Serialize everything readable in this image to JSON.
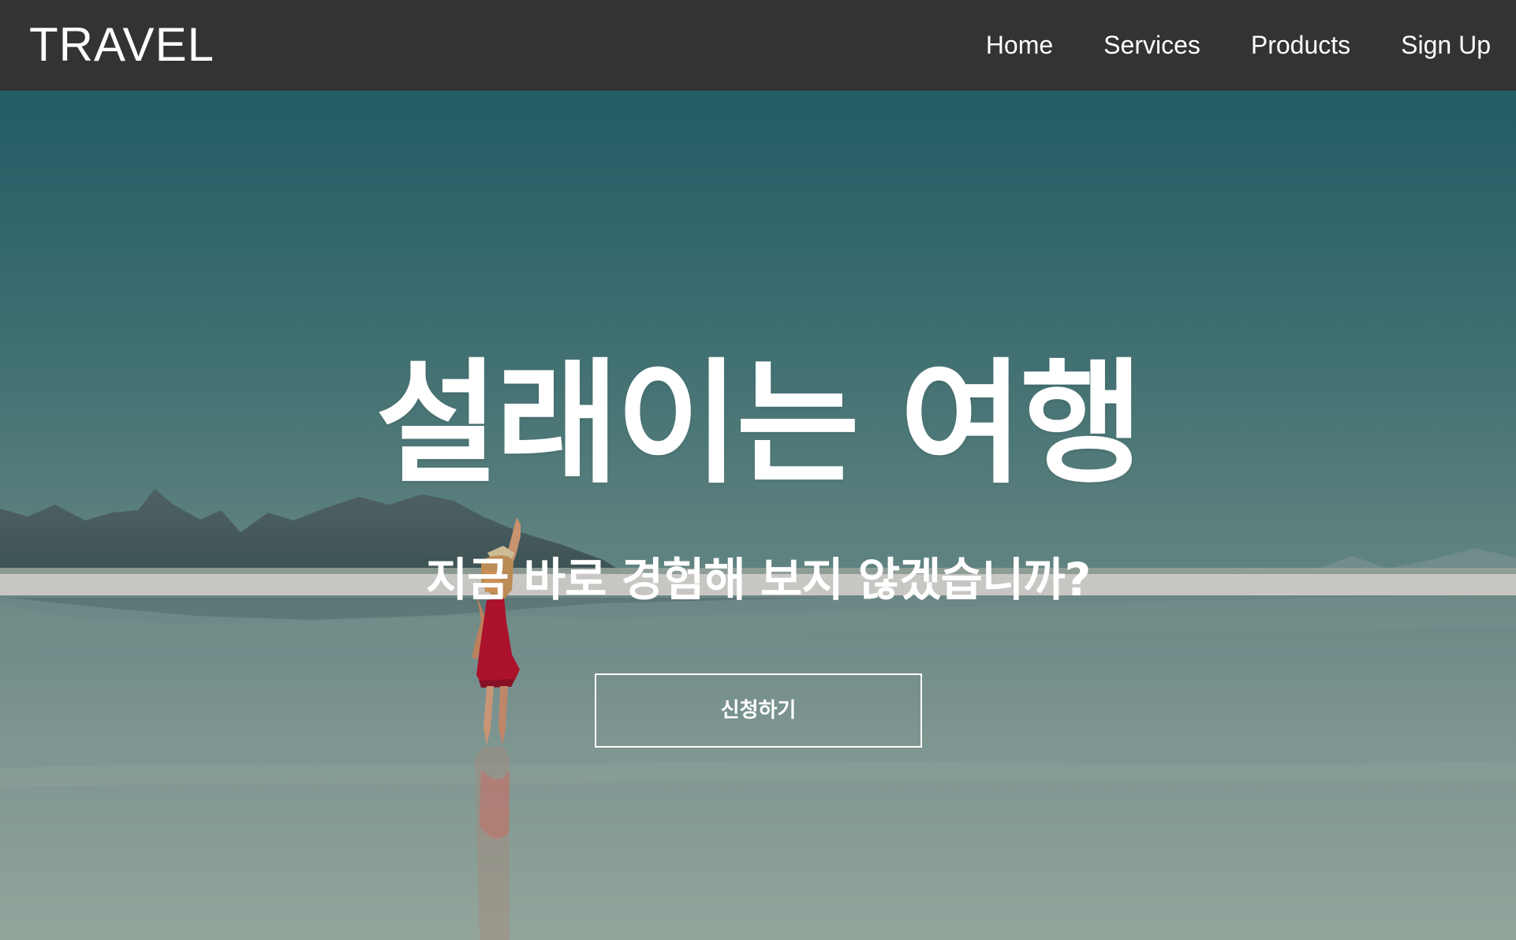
{
  "brand": {
    "title": "TRAVEL"
  },
  "nav": {
    "items": [
      {
        "label": "Home"
      },
      {
        "label": "Services"
      },
      {
        "label": "Products"
      },
      {
        "label": "Sign Up"
      }
    ]
  },
  "hero": {
    "title": "설래이는 여행",
    "subtitle": "지금 바로 경험해 보지 않겠습니까?",
    "button_label": "신청하기",
    "background_colors": {
      "sky": "#286168",
      "water": "#95ab9f",
      "mountains": "#4c5f61",
      "dress": "#b5122c"
    }
  }
}
